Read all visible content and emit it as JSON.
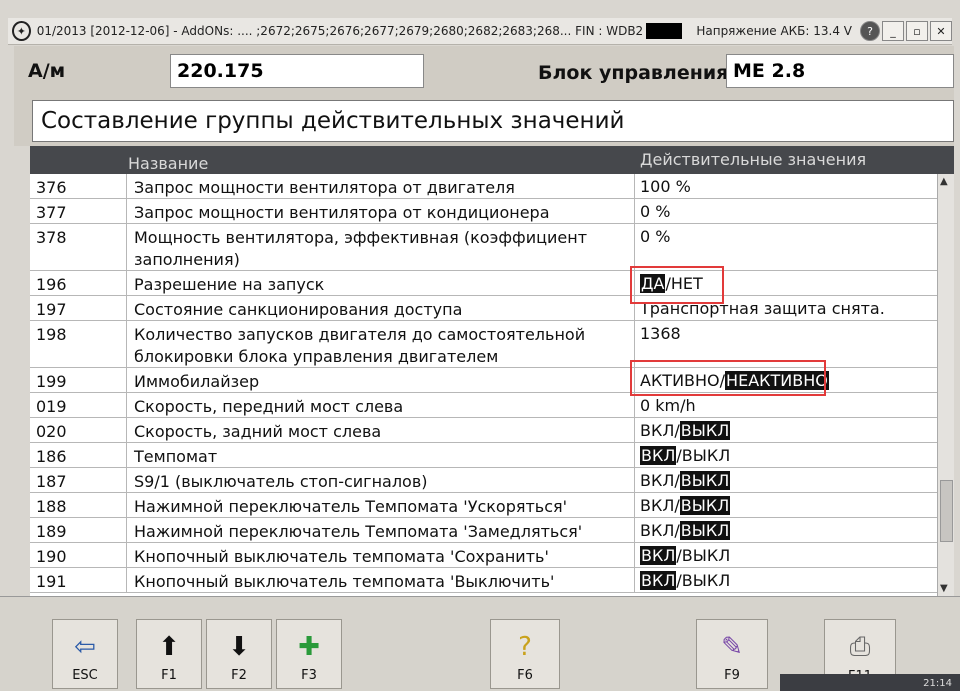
{
  "titlebar": {
    "text": "01/2013 [2012-12-06] - AddONs:  ....  ;2672;2675;2676;2677;2679;2680;2682;2683;268...  FIN : WDB2201751A",
    "battery": "Напряжение АКБ: 13.4 V"
  },
  "header": {
    "am_label": "А/м",
    "am_value": "220.175",
    "ecu_label": "Блок управления",
    "ecu_value": "ME 2.8",
    "group_title": "Составление группы действительных значений"
  },
  "table": {
    "col_name": "Название",
    "col_value": "Действительные значения",
    "rows": [
      {
        "id": "376",
        "name": "Запрос мощности вентилятора от двигателя",
        "value": "100 %"
      },
      {
        "id": "377",
        "name": "Запрос мощности вентилятора от кондиционера",
        "value": "0 %"
      },
      {
        "id": "378",
        "name": "Мощность вентилятора, эффективная (коэффициент заполнения)",
        "value": "0 %"
      },
      {
        "id": "196",
        "name": "Разрешение на запуск",
        "value_a": "ДА",
        "value_sep": "/",
        "value_b": "НЕТ"
      },
      {
        "id": "197",
        "name": "Состояние санкционирования доступа",
        "value": "Транспортная защита снята."
      },
      {
        "id": "198",
        "name": "Количество запусков двигателя до самостоятельной блокировки блока управления двигателем",
        "value": "1368"
      },
      {
        "id": "199",
        "name": "Иммобилайзер",
        "value_a": "АКТИВНО",
        "value_sep": "/",
        "value_b": "НЕАКТИВНО"
      },
      {
        "id": "019",
        "name": "Скорость, передний мост слева",
        "value": "0 km/h"
      },
      {
        "id": "020",
        "name": "Скорость, задний мост слева",
        "value_a": "ВКЛ",
        "value_sep": "/",
        "value_b": "ВЫКЛ"
      },
      {
        "id": "186",
        "name": "Темпомат",
        "value_a": "ВКЛ",
        "value_sep": "/",
        "value_b": "ВЫКЛ"
      },
      {
        "id": "187",
        "name": "S9/1 (выключатель стоп-сигналов)",
        "value_a": "ВКЛ",
        "value_sep": "/",
        "value_b": "ВЫКЛ"
      },
      {
        "id": "188",
        "name": "Нажимной переключатель Темпомата 'Ускоряться'",
        "value_a": "ВКЛ",
        "value_sep": "/",
        "value_b": "ВЫКЛ"
      },
      {
        "id": "189",
        "name": "Нажимной переключатель Темпомата 'Замедляться'",
        "value_a": "ВКЛ",
        "value_sep": "/",
        "value_b": "ВЫКЛ"
      },
      {
        "id": "190",
        "name": "Кнопочный выключатель темпомата 'Сохранить'",
        "value_a": "ВКЛ",
        "value_sep": "/",
        "value_b": "ВЫКЛ"
      },
      {
        "id": "191",
        "name": "Кнопочный выключатель темпомата 'Выключить'",
        "value_a": "ВКЛ",
        "value_sep": "/",
        "value_b": "ВЫКЛ"
      }
    ]
  },
  "toolbar": {
    "esc": "ESC",
    "f1": "F1",
    "f2": "F2",
    "f3": "F3",
    "f6": "F6",
    "f9": "F9",
    "f11": "F11"
  },
  "taskbar": {
    "time": "21:14"
  },
  "colors": {
    "highlight_box": "#e23a3a",
    "header_bg": "#46484c"
  }
}
